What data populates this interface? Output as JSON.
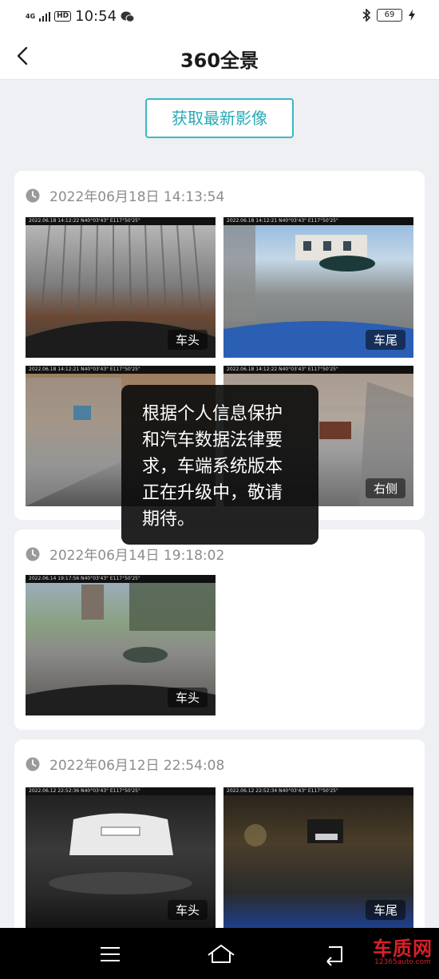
{
  "status_bar": {
    "network": "4G",
    "hd": "HD",
    "time": "10:54",
    "battery": "69"
  },
  "header": {
    "title": "360全景"
  },
  "fetch_button": {
    "label": "获取最新影像"
  },
  "records": [
    {
      "date": "2022年06月18日 14:13:54",
      "photos": [
        {
          "stamp": "2022.06.18  14:12:22   N40°03'43\"  E117°50'25\"",
          "label": "车头"
        },
        {
          "stamp": "2022.06.18  14:12:21   N40°03'43\"  E117°50'25\"",
          "label": "车尾"
        },
        {
          "stamp": "2022.06.18  14:12:21   N40°03'43\"  E117°50'25\"",
          "label": ""
        },
        {
          "stamp": "2022.06.18  14:12:22   N40°03'43\"  E117°50'25\"",
          "label": "右侧"
        }
      ]
    },
    {
      "date": "2022年06月14日 19:18:02",
      "photos": [
        {
          "stamp": "2022.06.14  19:17:56   N40°03'43\"  E117°50'25\"",
          "label": "车头"
        }
      ]
    },
    {
      "date": "2022年06月12日 22:54:08",
      "photos": [
        {
          "stamp": "2022.06.12  22:52:36   N40°03'43\"  E117°50'25\"",
          "label": "车头"
        },
        {
          "stamp": "2022.06.12  22:52:34   N40°03'43\"  E117°50'25\"",
          "label": "车尾"
        }
      ]
    }
  ],
  "toast": {
    "message": "根据个人信息保护和汽车数据法律要求，车端系统版本正在升级中，敬请期待。"
  },
  "watermark": {
    "brand": "车质网",
    "url": "12365auto.com"
  }
}
